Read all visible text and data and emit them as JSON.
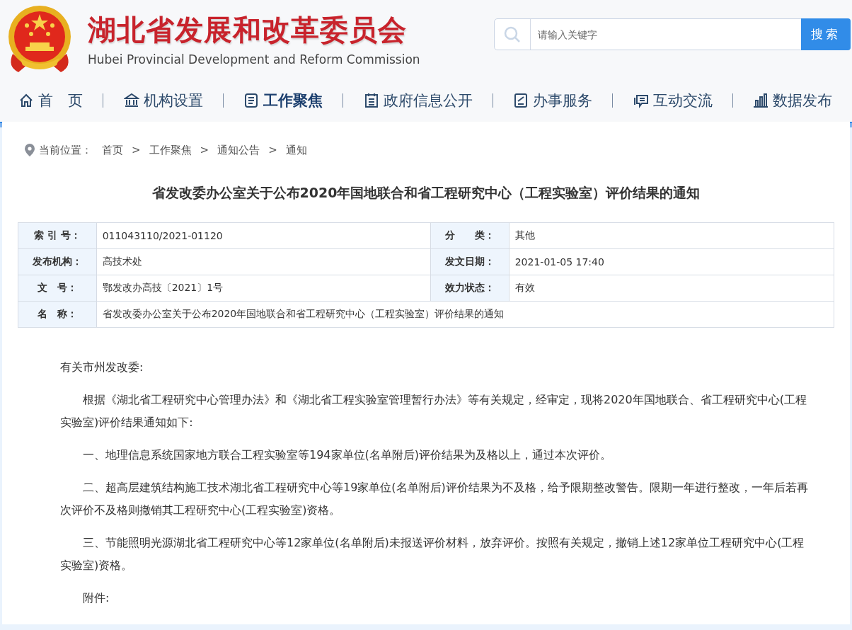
{
  "header": {
    "title": "湖北省发展和改革委员会",
    "subtitle": "Hubei Provincial Development and Reform Commission"
  },
  "search": {
    "placeholder": "请输入关键字",
    "button": "搜索"
  },
  "nav": [
    {
      "label": "首　页",
      "selected": false
    },
    {
      "label": "机构设置",
      "selected": false
    },
    {
      "label": "工作聚焦",
      "selected": true
    },
    {
      "label": "政府信息公开",
      "selected": false
    },
    {
      "label": "办事服务",
      "selected": false
    },
    {
      "label": "互动交流",
      "selected": false
    },
    {
      "label": "数据发布",
      "selected": false
    }
  ],
  "breadcrumb": {
    "label": "当前位置：",
    "separator": ">",
    "items": [
      "首页",
      "工作聚焦",
      "通知公告",
      "通知"
    ]
  },
  "article_title": "省发改委办公室关于公布2020年国地联合和省工程研究中心（工程实验室）评价结果的通知",
  "info_table": [
    [
      {
        "label": "索 引 号：",
        "value": "011043110/2021-01120"
      },
      {
        "label": "分　　类：",
        "value": "其他"
      }
    ],
    [
      {
        "label": "发布机构：",
        "value": "高技术处"
      },
      {
        "label": "发文日期：",
        "value": "2021-01-05 17:40"
      }
    ],
    [
      {
        "label": "文　号：",
        "value": "鄂发改办高技〔2021〕1号"
      },
      {
        "label": "效力状态：",
        "value": "有效"
      }
    ],
    [
      {
        "label": "名　称：",
        "value": "省发改委办公室关于公布2020年国地联合和省工程研究中心（工程实验室）评价结果的通知"
      }
    ]
  ],
  "body": [
    {
      "kind": "salutation",
      "text": "有关市州发改委:"
    },
    {
      "kind": "paragraph",
      "text": "根据《湖北省工程研究中心管理办法》和《湖北省工程实验室管理暂行办法》等有关规定，经审定，现将2020年国地联合、省工程研究中心(工程实验室)评价结果通知如下:"
    },
    {
      "kind": "paragraph",
      "text": "一、地理信息系统国家地方联合工程实验室等194家单位(名单附后)评价结果为及格以上，通过本次评价。"
    },
    {
      "kind": "paragraph",
      "text": "二、超高层建筑结构施工技术湖北省工程研究中心等19家单位(名单附后)评价结果为不及格，给予限期整改警告。限期一年进行整改，一年后若再次评价不及格则撤销其工程研究中心(工程实验室)资格。"
    },
    {
      "kind": "paragraph",
      "text": "三、节能照明光源湖北省工程研究中心等12家单位(名单附后)未报送评价材料，放弃评价。按照有关规定，撤销上述12家单位工程研究中心(工程实验室)资格。"
    },
    {
      "kind": "paragraph",
      "text": "附件:"
    }
  ]
}
